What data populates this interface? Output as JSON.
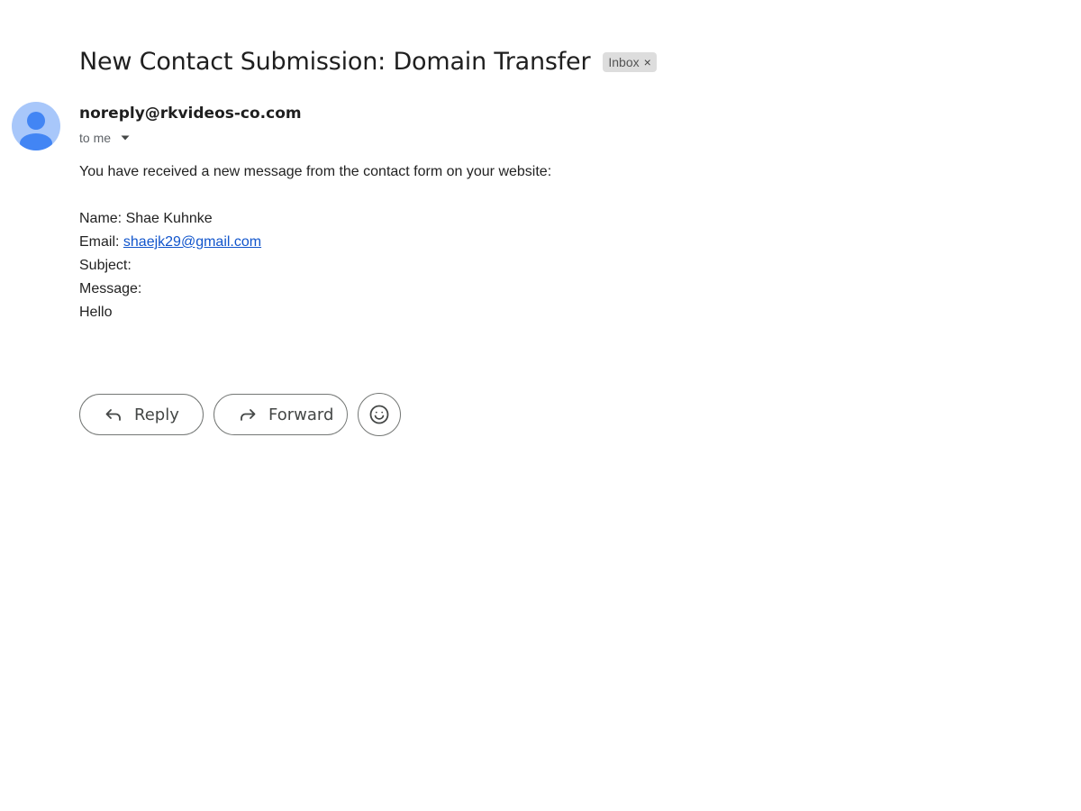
{
  "email": {
    "subject": "New Contact Submission: Domain Transfer",
    "label": "Inbox",
    "label_remove": "×",
    "sender": "noreply@rkvideos-co.com",
    "recipient_text": "to me",
    "body": {
      "intro": "You have received a new message from the contact form on your website:",
      "name_line": "Name: Shae Kuhnke",
      "email_label": "Email: ",
      "email_link": "shaejk29@gmail.com",
      "subject_line": "Subject:",
      "message_label": "Message:",
      "message_text": "Hello"
    }
  },
  "actions": {
    "reply_label": "Reply",
    "forward_label": "Forward"
  },
  "icons": {
    "avatar": "person-icon",
    "caret": "caret-down-icon",
    "reply": "reply-arrow-icon",
    "forward": "forward-arrow-icon",
    "emoji": "smiley-icon"
  },
  "colors": {
    "avatar_bg": "#a8c7fa",
    "avatar_figure": "#4285f4",
    "link": "#1155cc",
    "chip_bg": "#dddddd"
  }
}
